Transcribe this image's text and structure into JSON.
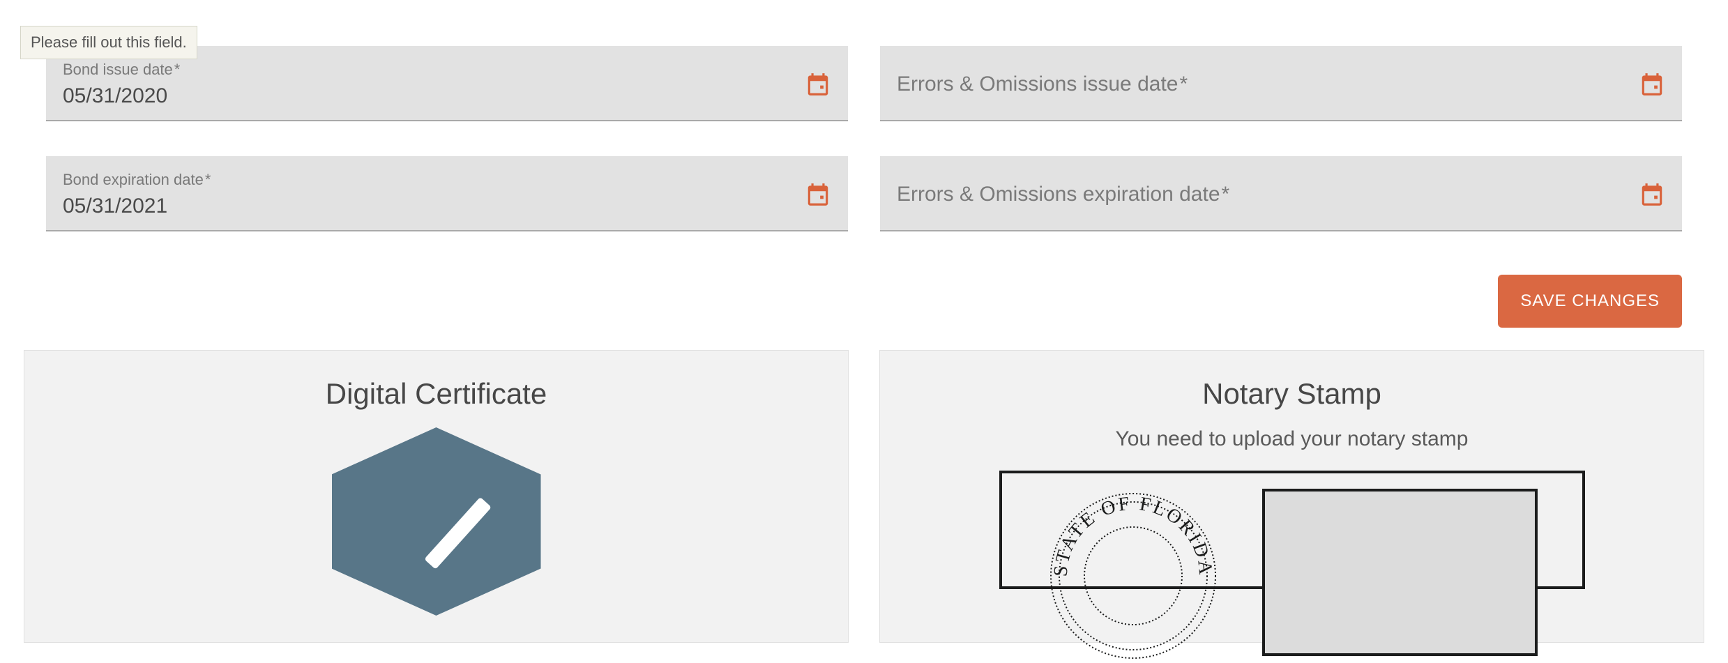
{
  "tooltip": "Please fill out this field.",
  "fields": {
    "bond_issue": {
      "label": "Bond issue date",
      "required_mark": "*",
      "value": "05/31/2020"
    },
    "bond_expiration": {
      "label": "Bond expiration date",
      "required_mark": "*",
      "value": "05/31/2021"
    },
    "eo_issue": {
      "label": "Errors & Omissions issue date",
      "required_mark": "*",
      "value": ""
    },
    "eo_expiration": {
      "label": "Errors & Omissions expiration date",
      "required_mark": "*",
      "value": ""
    }
  },
  "buttons": {
    "save": "SAVE CHANGES"
  },
  "panels": {
    "certificate": {
      "title": "Digital Certificate"
    },
    "stamp": {
      "title": "Notary Stamp",
      "subtext": "You need to upload your notary stamp",
      "seal_text": "STATE OF FLORIDA"
    }
  }
}
